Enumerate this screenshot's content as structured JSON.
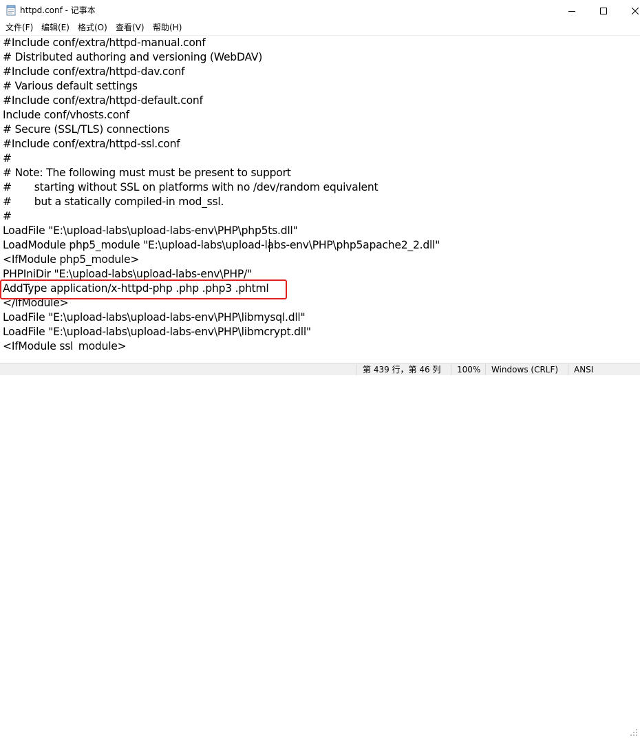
{
  "window": {
    "title": "httpd.conf - 记事本",
    "icons": {
      "app": "notepad-icon",
      "minimize": "minimize-icon",
      "maximize": "maximize-icon",
      "close": "close-icon"
    }
  },
  "menu": {
    "items": [
      {
        "label": "文件(F)"
      },
      {
        "label": "编辑(E)"
      },
      {
        "label": "格式(O)"
      },
      {
        "label": "查看(V)"
      },
      {
        "label": "帮助(H)"
      }
    ]
  },
  "editor": {
    "lines": [
      "#Include conf/extra/httpd-manual.conf",
      "# Distributed authoring and versioning (WebDAV)",
      "#Include conf/extra/httpd-dav.conf",
      "# Various default settings",
      "#Include conf/extra/httpd-default.conf",
      "Include conf/vhosts.conf",
      "# Secure (SSL/TLS) connections",
      "#Include conf/extra/httpd-ssl.conf",
      "#",
      "# Note: The following must must be present to support",
      "#       starting without SSL on platforms with no /dev/random equivalent",
      "#       but a statically compiled-in mod_ssl.",
      "#",
      "LoadFile \"E:\\upload-labs\\upload-labs-env\\PHP\\php5ts.dll\"",
      "LoadModule php5_module \"E:\\upload-labs\\upload-labs-env\\PHP\\php5apache2_2.dll\"",
      "<IfModule php5_module>",
      "PHPIniDir \"E:\\upload-labs\\upload-labs-env\\PHP/\"",
      "AddType application/x-httpd-php .php .php3 .phtml",
      "</IfModule>",
      "LoadFile \"E:\\upload-labs\\upload-labs-env\\PHP\\libmysql.dll\"",
      "LoadFile \"E:\\upload-labs\\upload-labs-env\\PHP\\libmcrypt.dll\"",
      "<IfModule ssl_module>"
    ],
    "highlight_color": "#e02020"
  },
  "status": {
    "position": "第 439 行，第 46 列",
    "zoom": "100%",
    "line_ending": "Windows (CRLF)",
    "encoding": "ANSI"
  }
}
